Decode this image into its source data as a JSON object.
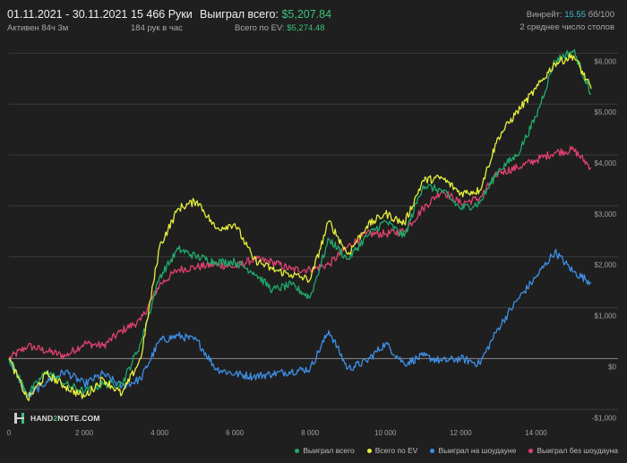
{
  "header": {
    "date_range": "01.11.2021 - 30.11.2021",
    "active": "Активен 84ч 3м",
    "hands": "15 466 Руки",
    "hands_per_hour": "184 рук в час",
    "won_label": "Выиграл всего:",
    "won_value": "$5,207.84",
    "ev_label": "Всего по EV:",
    "ev_value": "$5,274.48",
    "winrate_label": "Винрейт:",
    "winrate_value": "15.55",
    "winrate_suffix": "бб/100",
    "tables": "2 среднее число столов"
  },
  "logo": {
    "text_a": "HAND",
    "text_b": "2",
    "text_c": "NOTE.COM"
  },
  "colors": {
    "won": "#1faa6b",
    "ev": "#e6f03c",
    "showdown": "#3d8fe6",
    "non_showdown": "#e0416f",
    "grid": "#3a3a3a",
    "zero": "#8a8a8a"
  },
  "chart_data": {
    "type": "line",
    "title": "",
    "xlabel": "",
    "ylabel": "",
    "xlim": [
      0,
      15466
    ],
    "ylim": [
      -1400,
      6200
    ],
    "x_ticks": [
      0,
      2000,
      4000,
      6000,
      8000,
      10000,
      12000,
      14000
    ],
    "x_tick_labels": [
      "0",
      "2 000",
      "4 000",
      "6 000",
      "8 000",
      "10 000",
      "12 000",
      "14 000"
    ],
    "y_ticks": [
      -1000,
      0,
      1000,
      2000,
      3000,
      4000,
      5000,
      6000
    ],
    "y_tick_labels": [
      "-$1,000",
      "$0",
      "$1,000",
      "$2,000",
      "$3,000",
      "$4,000",
      "$5,000",
      "$6,000"
    ],
    "legend_position": "bottom-right",
    "x": [
      0,
      500,
      1000,
      1500,
      2000,
      2500,
      3000,
      3500,
      4000,
      4500,
      5000,
      5500,
      6000,
      6500,
      7000,
      7500,
      8000,
      8500,
      9000,
      9500,
      10000,
      10500,
      11000,
      11500,
      12000,
      12500,
      13000,
      13500,
      14000,
      14500,
      15000,
      15466
    ],
    "series": [
      {
        "name": "Выиграл всего",
        "color": "#1faa6b",
        "values": [
          0,
          -700,
          -250,
          -500,
          -650,
          -500,
          -500,
          300,
          1600,
          2150,
          2000,
          1900,
          1900,
          1700,
          1350,
          1450,
          1200,
          2350,
          1950,
          2400,
          2700,
          2400,
          3400,
          3300,
          2950,
          3050,
          3700,
          4000,
          4750,
          5850,
          6050,
          5200
        ]
      },
      {
        "name": "Всего по EV",
        "color": "#e6f03c",
        "values": [
          0,
          -800,
          -300,
          -550,
          -750,
          -400,
          -700,
          0,
          2200,
          2950,
          3100,
          2550,
          2650,
          1950,
          1750,
          1650,
          1550,
          2700,
          2050,
          2600,
          2850,
          2650,
          3500,
          3550,
          3250,
          3300,
          4350,
          4850,
          5300,
          5800,
          5950,
          5300
        ]
      },
      {
        "name": "Выиграл на шоудауне",
        "color": "#3d8fe6",
        "values": [
          0,
          -750,
          -450,
          -250,
          -500,
          -300,
          -550,
          -400,
          350,
          450,
          350,
          -200,
          -300,
          -350,
          -300,
          -250,
          -200,
          550,
          -200,
          -50,
          300,
          -100,
          50,
          -50,
          0,
          -100,
          600,
          1150,
          1600,
          2100,
          1700,
          1500
        ]
      },
      {
        "name": "Выиграл без шоудауна",
        "color": "#e0416f",
        "values": [
          0,
          250,
          150,
          50,
          300,
          250,
          550,
          750,
          1450,
          1750,
          1800,
          1850,
          1800,
          1950,
          1900,
          1750,
          1750,
          1850,
          2200,
          2450,
          2450,
          2500,
          2950,
          3300,
          3050,
          3150,
          3650,
          3750,
          3900,
          4050,
          4100,
          3750
        ]
      }
    ]
  }
}
